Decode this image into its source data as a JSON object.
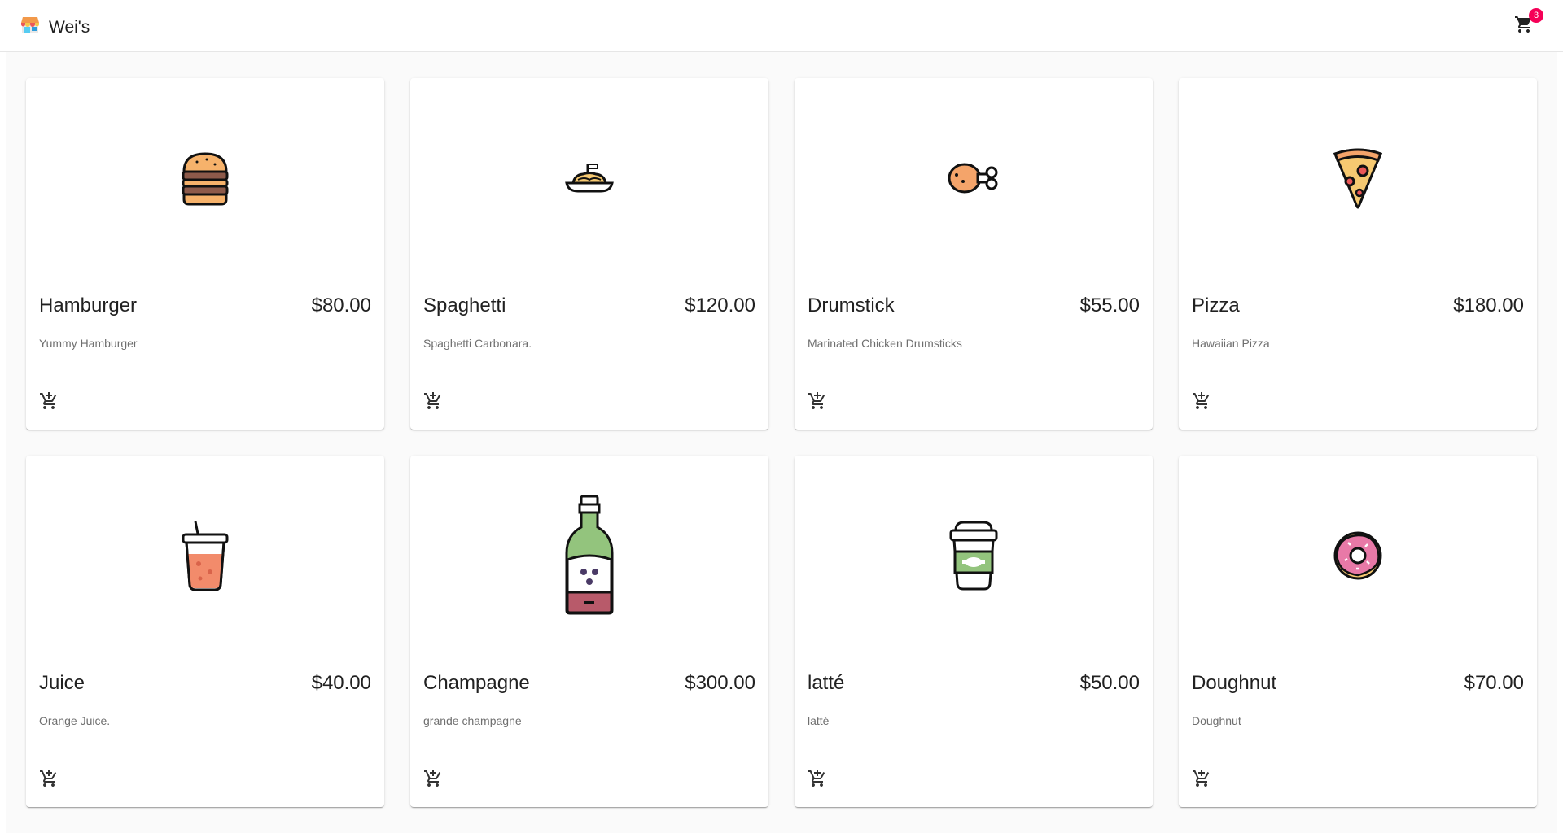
{
  "app": {
    "title": "Wei's",
    "logo_icon": "store-icon"
  },
  "cart": {
    "count": "3",
    "icon": "shopping-cart-icon",
    "badge_color": "#f50057"
  },
  "products": [
    {
      "name": "Hamburger",
      "price": "$80.00",
      "description": "Yummy Hamburger",
      "icon": "hamburger-icon"
    },
    {
      "name": "Spaghetti",
      "price": "$120.00",
      "description": "Spaghetti Carbonara.",
      "icon": "spaghetti-icon"
    },
    {
      "name": "Drumstick",
      "price": "$55.00",
      "description": "Marinated Chicken Drumsticks",
      "icon": "drumstick-icon"
    },
    {
      "name": "Pizza",
      "price": "$180.00",
      "description": "Hawaiian Pizza",
      "icon": "pizza-icon"
    },
    {
      "name": "Juice",
      "price": "$40.00",
      "description": "Orange Juice.",
      "icon": "juice-icon"
    },
    {
      "name": "Champagne",
      "price": "$300.00",
      "description": "grande champagne",
      "icon": "champagne-bottle-icon"
    },
    {
      "name": "latté",
      "price": "$50.00",
      "description": "latté",
      "icon": "coffee-cup-icon"
    },
    {
      "name": "Doughnut",
      "price": "$70.00",
      "description": "Doughnut",
      "icon": "doughnut-icon"
    }
  ]
}
